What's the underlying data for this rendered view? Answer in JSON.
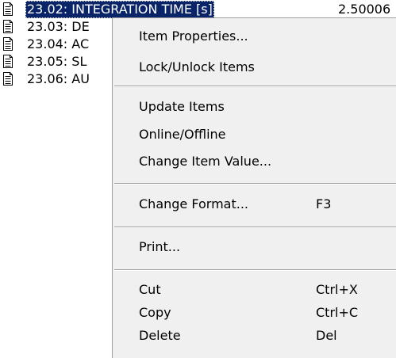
{
  "list": {
    "rows": [
      {
        "label": "23.02: INTEGRATION TIME [s]",
        "value": "2.50006"
      },
      {
        "label": "23.03: DE"
      },
      {
        "label": "23.04: AC"
      },
      {
        "label": "23.05: SL"
      },
      {
        "label": "23.06: AU"
      }
    ]
  },
  "context_menu": {
    "item_properties": "Item Properties...",
    "lock_unlock": "Lock/Unlock Items",
    "update_items": "Update Items",
    "online_offline": "Online/Offline",
    "change_item_value": "Change Item Value...",
    "change_format": "Change Format...",
    "change_format_shortcut": "F3",
    "print": "Print...",
    "cut": "Cut",
    "cut_shortcut": "Ctrl+X",
    "copy": "Copy",
    "copy_shortcut": "Ctrl+C",
    "delete": "Delete",
    "delete_shortcut": "Del"
  },
  "colors": {
    "selection_background": "#0a246a",
    "menu_background": "#f0f0f0",
    "separator": "#a0a0a0"
  },
  "icons": {
    "row_icon": "document-icon"
  }
}
